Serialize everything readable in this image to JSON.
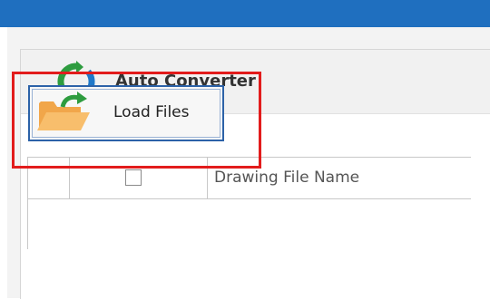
{
  "app": {
    "title": "Auto Converter",
    "icon": "sync-arrows-icon",
    "icon_colors": {
      "green": "#2e9c3f",
      "blue": "#1f78c9"
    }
  },
  "toolbar": {
    "load_files_label": "Load Files",
    "load_files_icon": "open-folder-icon"
  },
  "grid": {
    "columns": [
      "",
      "",
      "Drawing File Name"
    ],
    "rows": []
  },
  "colors": {
    "titlebar": "#1f6fbf",
    "highlight": "#e21c1c",
    "button_border": "#2c62a8"
  }
}
